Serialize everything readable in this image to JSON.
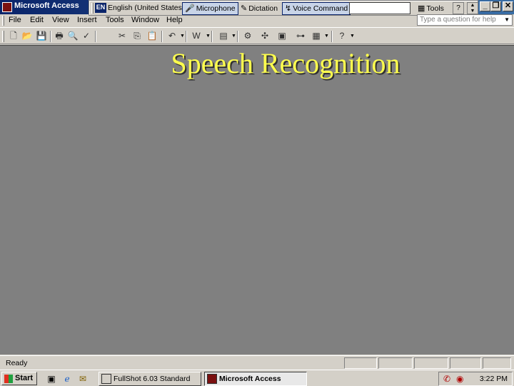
{
  "window": {
    "title": "Microsoft Access",
    "controls": {
      "help": "?",
      "minimize": "_",
      "restore": "❐",
      "close": "✕"
    }
  },
  "language_bar": {
    "language_code": "EN",
    "language": "English (United States)",
    "microphone": "Microphone",
    "dictation": "Dictation",
    "voice_command": "Voice Command",
    "tools": "Tools"
  },
  "menu": [
    "File",
    "Edit",
    "View",
    "Insert",
    "Tools",
    "Window",
    "Help"
  ],
  "help_box": {
    "placeholder": "Type a question for help"
  },
  "toolbar": {
    "icons": [
      "new-icon",
      "open-icon",
      "save-icon",
      "print-icon",
      "print-preview-icon",
      "spelling-icon",
      "cut-icon",
      "copy-icon",
      "paste-icon",
      "undo-icon",
      "office-links-icon",
      "analyze-icon",
      "code-icon",
      "microsoft-script-editor-icon",
      "properties-icon",
      "relationships-icon",
      "new-object-icon",
      "help-icon"
    ]
  },
  "slide": {
    "title": "Speech Recognition"
  },
  "status": {
    "text": "Ready"
  },
  "taskbar": {
    "start": "Start",
    "tasks": [
      {
        "label": "FullShot 6.03 Standard",
        "active": false
      },
      {
        "label": "Microsoft Access",
        "active": true
      }
    ],
    "clock": "3:22 PM"
  },
  "colors": {
    "title_text": "#ffff4d",
    "workspace": "#808080",
    "titlebar": "#0a246a"
  }
}
